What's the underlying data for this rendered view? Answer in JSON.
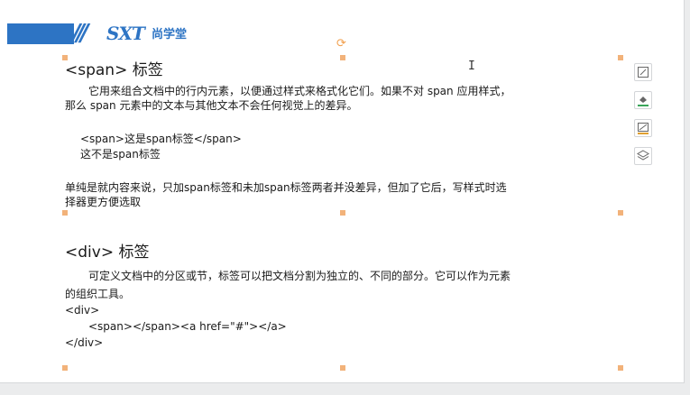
{
  "logo": {
    "mark": "SXT",
    "name": "尚学堂"
  },
  "span_section": {
    "title": "<span>  标签",
    "intro_line1": "它用来组合文档中的行内元素，以便通过样式来格式化它们。如果不对 span 应用样式，",
    "intro_line2": "那么 span 元素中的文本与其他文本不会任何视觉上的差异。",
    "example_line1": "<span>这是span标签</span>",
    "example_line2": "这不是span标签",
    "note_line1": "单纯是就内容来说，只加span标签和未加span标签两者并没差异，但加了它后，写样式时选",
    "note_line2": "择器更方便选取"
  },
  "div_section": {
    "title": "<div> 标签",
    "intro_line1": "可定义文档中的分区或节，标签可以把文档分割为独立的、不同的部分。它可以作为元素",
    "intro_line2": "的组织工具。",
    "code_line1": "<div>",
    "code_line2": "<span></span><a href=\"#\"></a>",
    "code_line3": "</div>"
  },
  "toolbar": {
    "icons": [
      "layout-icon",
      "fill-icon",
      "line-style-icon",
      "layers-icon"
    ],
    "colors": {
      "fill": "#3aa65a",
      "line": "#e0a030"
    }
  },
  "colors": {
    "brand": "#2d74c4",
    "handle": "#f2b27a"
  }
}
